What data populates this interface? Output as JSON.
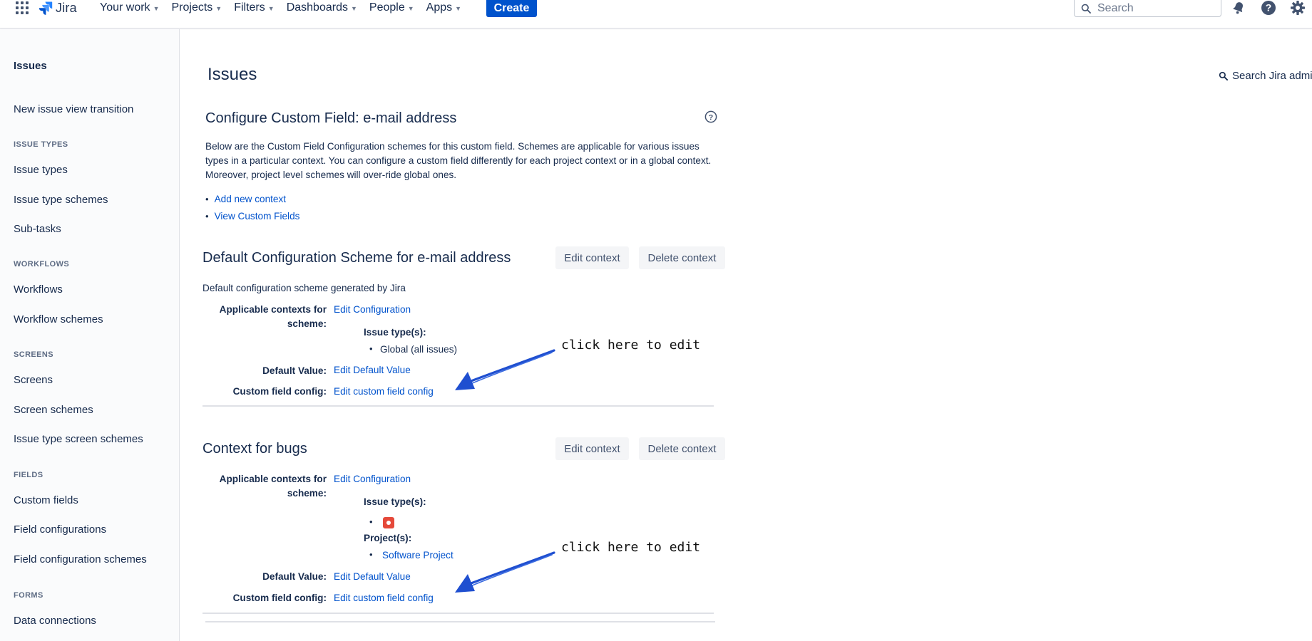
{
  "topnav": {
    "logo_text": "Jira",
    "items": [
      {
        "label": "Your work"
      },
      {
        "label": "Projects"
      },
      {
        "label": "Filters"
      },
      {
        "label": "Dashboards"
      },
      {
        "label": "People"
      },
      {
        "label": "Apps"
      }
    ],
    "create_label": "Create",
    "search_placeholder": "Search",
    "icons": [
      "app-switcher-icon",
      "jira-logo-icon",
      "notifications-icon",
      "help-icon",
      "settings-icon"
    ]
  },
  "sidebar": {
    "title": "Issues",
    "top_link": "New issue view transition",
    "groups": [
      {
        "heading": "ISSUE TYPES",
        "items": [
          "Issue types",
          "Issue type schemes",
          "Sub-tasks"
        ]
      },
      {
        "heading": "WORKFLOWS",
        "items": [
          "Workflows",
          "Workflow schemes"
        ]
      },
      {
        "heading": "SCREENS",
        "items": [
          "Screens",
          "Screen schemes",
          "Issue type screen schemes"
        ]
      },
      {
        "heading": "FIELDS",
        "items": [
          "Custom fields",
          "Field configurations",
          "Field configuration schemes"
        ]
      },
      {
        "heading": "FORMS",
        "items": [
          "Data connections"
        ]
      }
    ]
  },
  "main": {
    "page_title": "Issues",
    "search_admin": "Search Jira admi",
    "heading": "Configure Custom Field: e-mail address",
    "description": "Below are the Custom Field Configuration schemes for this custom field. Schemes are applicable for various issues types in a particular context. You can configure a custom field differently for each project context or in a global context. Moreover, project level schemes will over-ride global ones.",
    "links": [
      "Add new context",
      "View Custom Fields"
    ],
    "schemes": [
      {
        "title": "Default Configuration Scheme for e-mail address",
        "edit_label": "Edit context",
        "delete_label": "Delete context",
        "description": "Default configuration scheme generated by Jira",
        "applicable_label": "Applicable contexts for scheme:",
        "applicable_link": "Edit Configuration",
        "issue_types_label": "Issue type(s):",
        "issue_type_value": "Global (all issues)",
        "default_value_label": "Default Value:",
        "default_value_link": "Edit Default Value",
        "cf_config_label": "Custom field config:",
        "cf_config_link": "Edit custom field config",
        "annotation": "click here to edit"
      },
      {
        "title": "Context for bugs",
        "edit_label": "Edit context",
        "delete_label": "Delete context",
        "applicable_label": "Applicable contexts for scheme:",
        "applicable_link": "Edit Configuration",
        "issue_types_label": "Issue type(s):",
        "issue_type_icon": "bug-icon",
        "projects_label": "Project(s):",
        "project_value": "Software Project",
        "default_value_label": "Default Value:",
        "default_value_link": "Edit Default Value",
        "cf_config_label": "Custom field config:",
        "cf_config_link": "Edit custom field config",
        "annotation": "click here to edit"
      }
    ]
  },
  "colors": {
    "accent": "#0052cc",
    "text": "#172b4d",
    "annotation_arrow": "#1f4fd0",
    "bug": "#e5493a"
  }
}
